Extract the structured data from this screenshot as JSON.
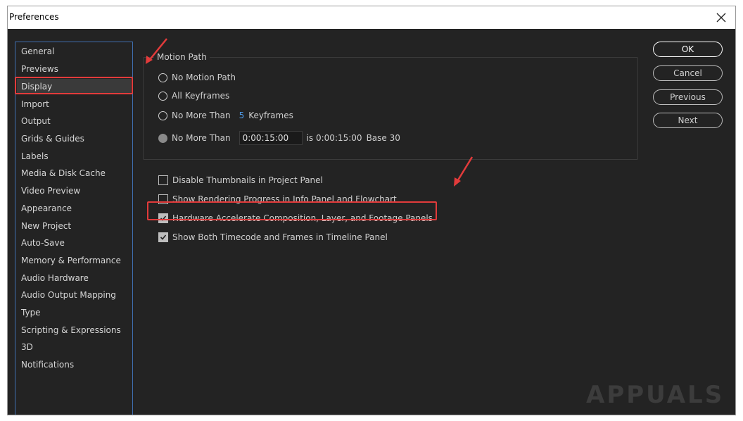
{
  "window": {
    "title": "Preferences"
  },
  "sidebar": {
    "items": [
      {
        "label": "General"
      },
      {
        "label": "Previews"
      },
      {
        "label": "Display"
      },
      {
        "label": "Import"
      },
      {
        "label": "Output"
      },
      {
        "label": "Grids & Guides"
      },
      {
        "label": "Labels"
      },
      {
        "label": "Media & Disk Cache"
      },
      {
        "label": "Video Preview"
      },
      {
        "label": "Appearance"
      },
      {
        "label": "New Project"
      },
      {
        "label": "Auto-Save"
      },
      {
        "label": "Memory & Performance"
      },
      {
        "label": "Audio Hardware"
      },
      {
        "label": "Audio Output Mapping"
      },
      {
        "label": "Type"
      },
      {
        "label": "Scripting & Expressions"
      },
      {
        "label": "3D"
      },
      {
        "label": "Notifications"
      }
    ],
    "selected": "Display"
  },
  "motion_path": {
    "group_label": "Motion Path",
    "options": [
      {
        "label": "No Motion Path"
      },
      {
        "label": "All Keyframes"
      },
      {
        "label": "No More Than",
        "value": "5",
        "suffix": "Keyframes"
      },
      {
        "label": "No More Than",
        "value": "0:00:15:00",
        "suffix": "is 0:00:15:00",
        "base": "Base 30"
      }
    ]
  },
  "checkboxes": [
    {
      "label": "Disable Thumbnails in Project Panel",
      "checked": false
    },
    {
      "label": "Show Rendering Progress in Info Panel and Flowchart",
      "checked": false
    },
    {
      "label": "Hardware Accelerate Composition, Layer, and Footage Panels",
      "checked": true
    },
    {
      "label": "Show Both Timecode and Frames in Timeline Panel",
      "checked": true
    }
  ],
  "buttons": {
    "ok": "OK",
    "cancel": "Cancel",
    "previous": "Previous",
    "next": "Next"
  },
  "watermark": {
    "text": "APPUALS"
  },
  "colors": {
    "accent_blue": "#4f9be8",
    "highlight_red": "#e23b3b",
    "background": "#232323",
    "sidebar_border": "#3f6fb0"
  }
}
